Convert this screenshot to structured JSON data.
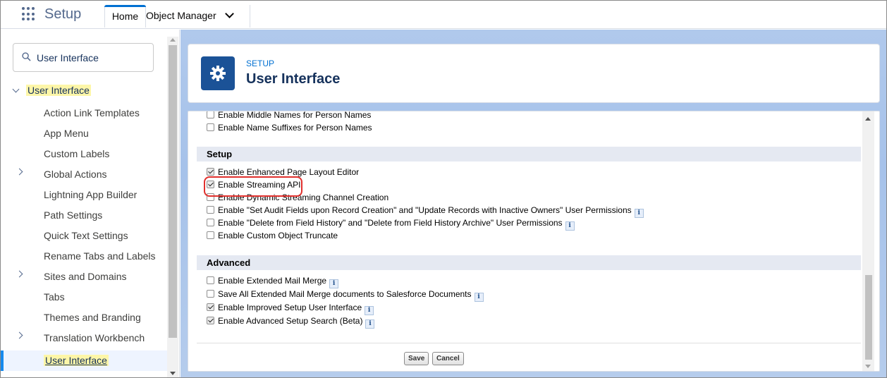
{
  "topbar": {
    "app_name": "Setup",
    "tabs": [
      {
        "label": "Home"
      },
      {
        "label": "Object Manager"
      }
    ]
  },
  "sidebar": {
    "search_value": "User Interface",
    "root_label": "User Interface",
    "items": [
      {
        "label": "Action Link Templates"
      },
      {
        "label": "App Menu"
      },
      {
        "label": "Custom Labels"
      },
      {
        "label": "Global Actions"
      },
      {
        "label": "Lightning App Builder"
      },
      {
        "label": "Path Settings"
      },
      {
        "label": "Quick Text Settings"
      },
      {
        "label": "Rename Tabs and Labels"
      },
      {
        "label": "Sites and Domains"
      },
      {
        "label": "Tabs"
      },
      {
        "label": "Themes and Branding"
      },
      {
        "label": "Translation Workbench"
      },
      {
        "label": "User Interface"
      }
    ]
  },
  "header": {
    "eyebrow": "SETUP",
    "title": "User Interface"
  },
  "settings": {
    "top_rows": [
      {
        "label": "Enable Middle Names for Person Names",
        "checked": false
      },
      {
        "label": "Enable Name Suffixes for Person Names",
        "checked": false
      }
    ],
    "setup_section": {
      "title": "Setup",
      "rows": [
        {
          "label": "Enable Enhanced Page Layout Editor",
          "checked": true
        },
        {
          "label": "Enable Streaming API",
          "checked": true
        },
        {
          "label": "Enable Dynamic Streaming Channel Creation",
          "checked": false
        },
        {
          "label": "Enable \"Set Audit Fields upon Record Creation\" and \"Update Records with Inactive Owners\" User Permissions",
          "checked": false
        },
        {
          "label": "Enable \"Delete from Field History\" and \"Delete from Field History Archive\" User Permissions",
          "checked": false
        },
        {
          "label": "Enable Custom Object Truncate",
          "checked": false
        }
      ]
    },
    "advanced_section": {
      "title": "Advanced",
      "rows": [
        {
          "label": "Enable Extended Mail Merge",
          "checked": false
        },
        {
          "label": "Save All Extended Mail Merge documents to Salesforce Documents",
          "checked": false
        },
        {
          "label": "Enable Improved Setup User Interface",
          "checked": true
        },
        {
          "label": "Enable Advanced Setup Search (Beta)",
          "checked": true
        }
      ]
    },
    "info_glyph": "i",
    "buttons": {
      "save": "Save",
      "cancel": "Cancel"
    }
  },
  "colors": {
    "accent": "#0070d2",
    "header_icon": "#1b5297",
    "highlight": "#fdf6a8",
    "callout": "#e0302d"
  }
}
